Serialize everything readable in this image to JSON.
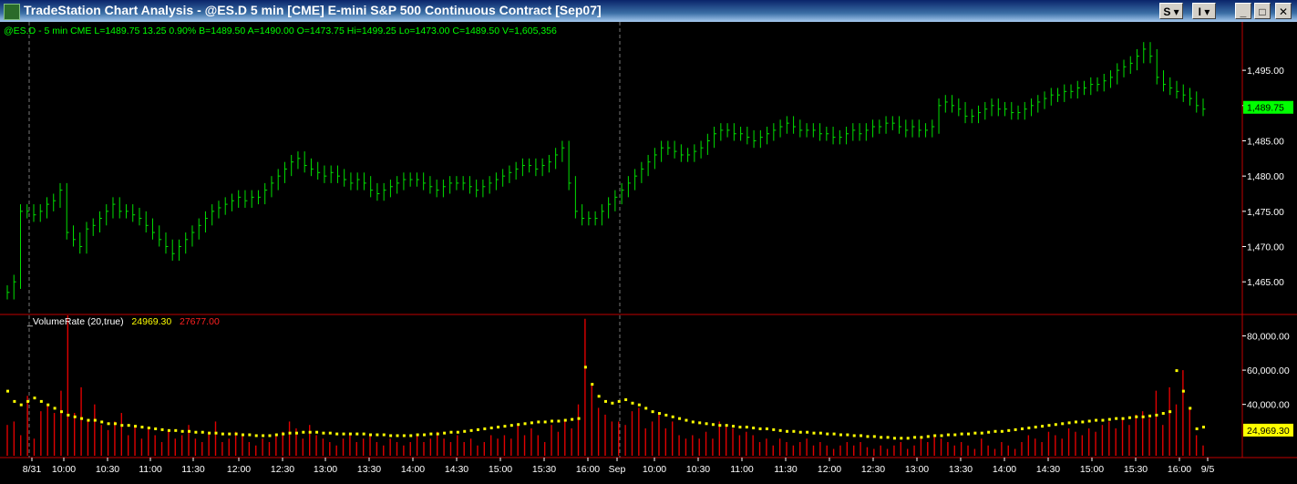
{
  "window": {
    "title": "TradeStation Chart Analysis - @ES.D  5 min  [CME] E-mini S&P 500 Continuous Contract [Sep07]",
    "btn_s": "S",
    "btn_i": "I",
    "btn_min": "_",
    "btn_max": "□",
    "btn_close": "✕"
  },
  "status": {
    "symbol": "@ES.D - 5 min  CME",
    "last": "L=1489.75",
    "change": "13.25",
    "pct": "0.90%",
    "bid": "B=1489.50",
    "ask": "A=1490.00",
    "open": "O=1473.75",
    "high": "Hi=1499.25",
    "low": "Lo=1473.00",
    "close": "C=1489.50",
    "volume": "V=1,605,356"
  },
  "volume_status": {
    "label": "_VolumeRate (20,true)",
    "v1": "24969.30",
    "v2": "27677.00"
  },
  "colors": {
    "price": "#00e000",
    "volume_bar": "#e00000",
    "avg_dot": "#ffff00",
    "last_tag": "#00ff00",
    "vol_tag": "#ffff00",
    "grid": "#5a5a5a"
  },
  "chart_data": [
    {
      "type": "bar",
      "title": "",
      "yticks": [
        "1,495.00",
        "1,490.00",
        "1,485.00",
        "1,480.00",
        "1,475.00",
        "1,470.00",
        "1,465.00"
      ],
      "ylim": [
        1460.5,
        1499.8
      ],
      "last_value_label": "1,489.75",
      "closes": [
        1463.5,
        1465,
        1475,
        1475,
        1474.5,
        1475,
        1476,
        1476.5,
        1478,
        1472,
        1471,
        1470,
        1472.5,
        1473,
        1474,
        1475,
        1476,
        1475,
        1475,
        1474.5,
        1474,
        1473,
        1472,
        1471,
        1470,
        1469,
        1470,
        1471,
        1472,
        1473,
        1474,
        1475,
        1475.5,
        1476,
        1476.5,
        1477,
        1476.5,
        1477,
        1477,
        1478,
        1479,
        1480,
        1481,
        1482,
        1482.5,
        1481.5,
        1481,
        1480.5,
        1480,
        1480.5,
        1480,
        1479.5,
        1479,
        1479.5,
        1479,
        1478,
        1477.5,
        1478,
        1478.5,
        1479,
        1479.5,
        1479.5,
        1479.5,
        1479,
        1478.5,
        1478,
        1478.5,
        1479,
        1479,
        1479,
        1478.5,
        1478,
        1478.5,
        1479,
        1479.5,
        1480,
        1480.5,
        1481,
        1481.5,
        1481.5,
        1481,
        1481.5,
        1482,
        1483,
        1484,
        1479,
        1475,
        1474,
        1474,
        1474,
        1475,
        1476,
        1477,
        1478,
        1479,
        1480,
        1481,
        1482,
        1483,
        1484,
        1484,
        1483.5,
        1483,
        1483,
        1483.5,
        1484,
        1485,
        1486,
        1486.5,
        1486.5,
        1486,
        1486,
        1485.5,
        1485,
        1485.5,
        1486,
        1486.5,
        1487,
        1487.5,
        1487,
        1486.5,
        1486.5,
        1486.5,
        1486,
        1486,
        1485.5,
        1485.5,
        1486,
        1486.5,
        1486,
        1486.5,
        1487,
        1487,
        1487.5,
        1487.5,
        1487,
        1486.5,
        1487,
        1486.5,
        1486.5,
        1487,
        1490,
        1490.5,
        1490,
        1489.5,
        1488.5,
        1488.5,
        1489,
        1489.5,
        1490,
        1489.5,
        1489.5,
        1489,
        1489,
        1489.5,
        1490,
        1490.5,
        1491,
        1491.5,
        1491.5,
        1492,
        1492,
        1492.5,
        1492.5,
        1493,
        1493,
        1493.5,
        1494,
        1495,
        1495.5,
        1496,
        1497,
        1498,
        1497,
        1494,
        1493,
        1492.5,
        1492,
        1491.5,
        1491,
        1490,
        1489.5
      ],
      "bar_range": 2
    },
    {
      "type": "bar",
      "title": "",
      "yticks": [
        "80,000.00",
        "60,000.00",
        "40,000.00"
      ],
      "ylim": [
        10000,
        92000
      ],
      "last_value_label": "24,969.30",
      "xticks": [
        "8/31",
        "10:00",
        "10:30",
        "11:00",
        "11:30",
        "12:00",
        "12:30",
        "13:00",
        "13:30",
        "14:00",
        "14:30",
        "15:00",
        "15:30",
        "16:00",
        "Sep",
        "10:00",
        "10:30",
        "11:00",
        "11:30",
        "12:00",
        "12:30",
        "13:00",
        "13:30",
        "14:00",
        "14:30",
        "15:00",
        "15:30",
        "16:00",
        "9/5"
      ],
      "volumes": [
        28000,
        30000,
        22000,
        45000,
        20000,
        36000,
        40000,
        35000,
        48000,
        92000,
        35000,
        50000,
        30000,
        40000,
        28000,
        25000,
        30000,
        35000,
        22000,
        28000,
        20000,
        26000,
        22000,
        18000,
        25000,
        20000,
        22000,
        28000,
        20000,
        18000,
        24000,
        30000,
        18000,
        20000,
        24000,
        22000,
        18000,
        16000,
        20000,
        18000,
        22000,
        24000,
        30000,
        26000,
        20000,
        28000,
        22000,
        20000,
        18000,
        16000,
        20000,
        22000,
        18000,
        20000,
        22000,
        18000,
        16000,
        20000,
        18000,
        16000,
        18000,
        22000,
        18000,
        20000,
        24000,
        20000,
        18000,
        22000,
        18000,
        20000,
        16000,
        18000,
        22000,
        20000,
        22000,
        20000,
        28000,
        22000,
        26000,
        22000,
        18000,
        28000,
        24000,
        30000,
        26000,
        40000,
        90000,
        52000,
        38000,
        34000,
        30000,
        30000,
        28000,
        36000,
        38000,
        26000,
        30000,
        34000,
        26000,
        30000,
        22000,
        20000,
        22000,
        20000,
        24000,
        20000,
        30000,
        28000,
        26000,
        22000,
        24000,
        22000,
        18000,
        20000,
        16000,
        20000,
        18000,
        16000,
        18000,
        20000,
        16000,
        18000,
        16000,
        14000,
        16000,
        18000,
        16000,
        18000,
        15000,
        14000,
        16000,
        14000,
        16000,
        18000,
        14000,
        16000,
        20000,
        18000,
        22000,
        20000,
        18000,
        16000,
        18000,
        16000,
        14000,
        20000,
        16000,
        14000,
        18000,
        16000,
        14000,
        18000,
        22000,
        20000,
        18000,
        24000,
        22000,
        20000,
        26000,
        24000,
        22000,
        26000,
        24000,
        28000,
        30000,
        26000,
        32000,
        28000,
        34000,
        36000,
        32000,
        48000,
        28000,
        50000,
        40000,
        60000,
        38000,
        22000,
        16000
      ],
      "averages": [
        48000,
        42000,
        40000,
        42000,
        44000,
        42000,
        40000,
        38000,
        36000,
        34000,
        33000,
        32000,
        31000,
        31000,
        30000,
        29000,
        29000,
        28000,
        28000,
        27500,
        27000,
        26500,
        26000,
        25500,
        25000,
        25000,
        24500,
        24500,
        24000,
        24000,
        23500,
        23500,
        23000,
        23000,
        23000,
        22500,
        22500,
        22000,
        22000,
        22000,
        22500,
        23000,
        23500,
        23500,
        24000,
        24000,
        24000,
        23500,
        23500,
        23000,
        23000,
        23000,
        23000,
        23000,
        22500,
        22500,
        22500,
        22000,
        22000,
        22000,
        22000,
        22500,
        22500,
        23000,
        23000,
        23500,
        24000,
        24000,
        24500,
        25000,
        25500,
        26000,
        26500,
        27000,
        27500,
        28000,
        28500,
        29000,
        29500,
        30000,
        30000,
        30500,
        30500,
        31000,
        31500,
        32000,
        62000,
        52000,
        45000,
        42000,
        41000,
        42000,
        43000,
        41000,
        40000,
        38000,
        36000,
        35000,
        34000,
        33000,
        32000,
        31000,
        30000,
        29500,
        29000,
        28500,
        28000,
        28000,
        27500,
        27000,
        27000,
        26500,
        26000,
        26000,
        25500,
        25000,
        24500,
        24500,
        24000,
        24000,
        23500,
        23500,
        23000,
        23000,
        22500,
        22500,
        22000,
        22000,
        21500,
        21500,
        21000,
        21000,
        20500,
        20500,
        20500,
        21000,
        21000,
        21500,
        22000,
        22000,
        22500,
        22500,
        23000,
        23000,
        23500,
        23500,
        24000,
        24500,
        24500,
        25000,
        25500,
        26000,
        26500,
        27000,
        27500,
        28000,
        28500,
        29000,
        29500,
        30000,
        30000,
        30500,
        31000,
        31000,
        31500,
        32000,
        32000,
        32500,
        33000,
        33000,
        33500,
        34000,
        35000,
        36000,
        60000,
        48000,
        38000,
        26000,
        27000
      ],
      "bar_range": 0
    }
  ]
}
